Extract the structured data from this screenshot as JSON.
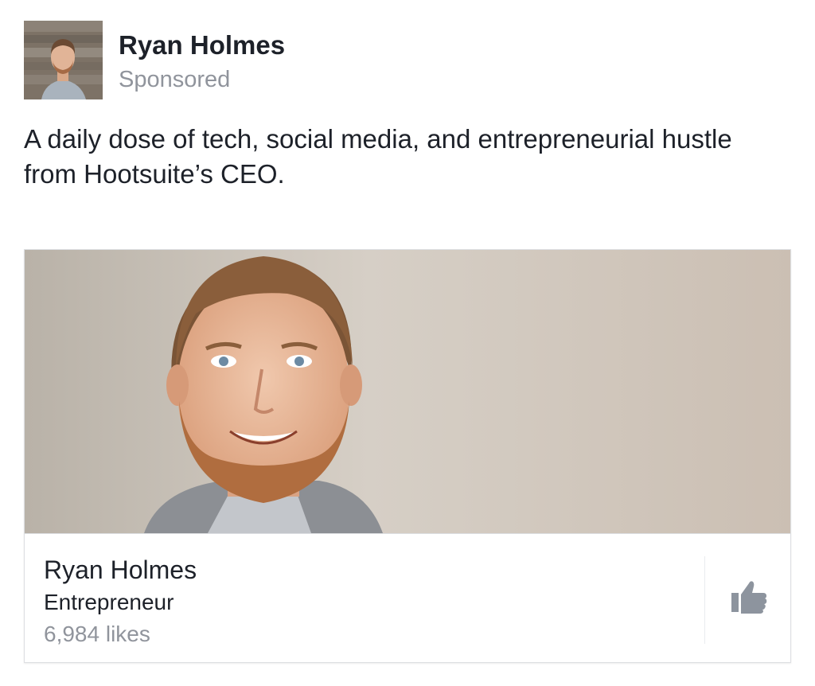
{
  "post": {
    "author": "Ryan Holmes",
    "sponsored_label": "Sponsored",
    "text": "A daily dose of tech, social media, and entrepreneurial hustle from Hootsuite’s CEO."
  },
  "card": {
    "page_name": "Ryan Holmes",
    "category": "Entrepreneur",
    "likes": "6,984 likes",
    "like_icon": "thumbs-up-icon"
  },
  "colors": {
    "text_primary": "#1d2129",
    "text_secondary": "#90949c",
    "like_icon": "#8d949e",
    "border": "#dddfe2"
  }
}
